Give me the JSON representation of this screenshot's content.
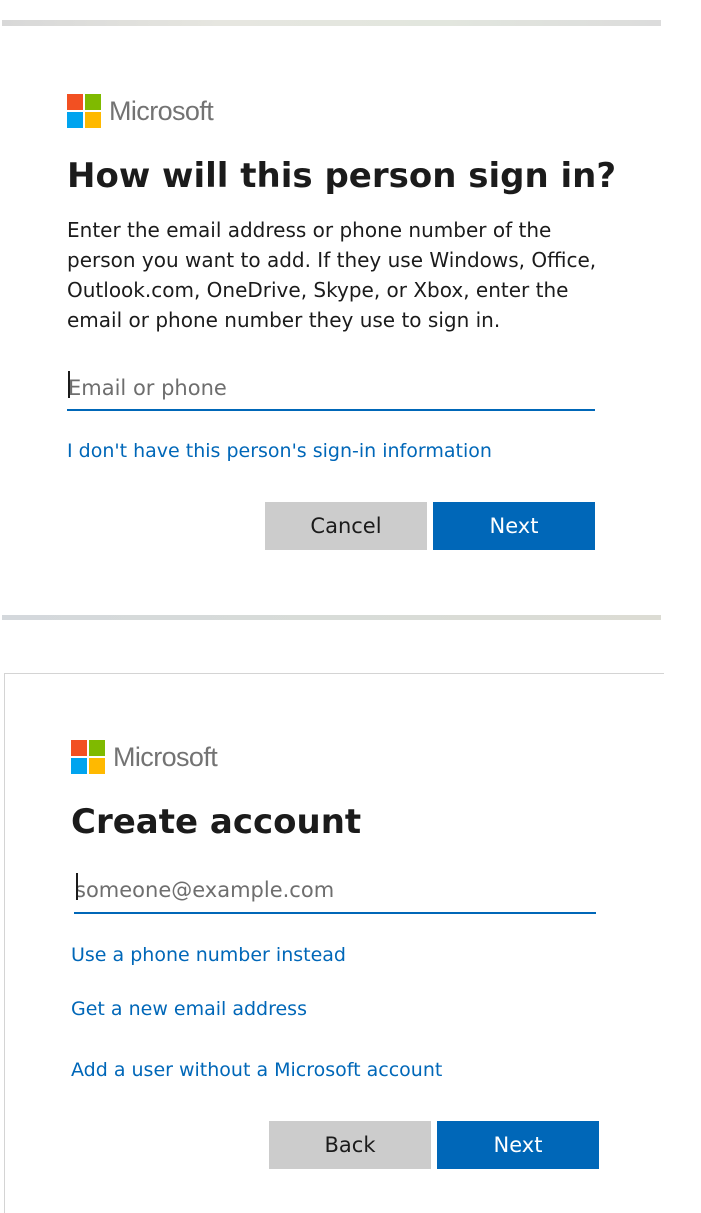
{
  "sign_in_panel": {
    "brand": "Microsoft",
    "title": "How will this person sign in?",
    "description": "Enter the email address or phone number of the person you want to add. If they use Windows, Office, Outlook.com, OneDrive, Skype, or Xbox, enter the email or phone number they use to sign in.",
    "email_input": {
      "placeholder": "Email or phone",
      "value": ""
    },
    "no_signin_info_link": "I don't have this person's sign-in information",
    "cancel_button": "Cancel",
    "next_button": "Next"
  },
  "create_account_panel": {
    "brand": "Microsoft",
    "title": "Create account",
    "email_input": {
      "placeholder": "someone@example.com",
      "value": ""
    },
    "use_phone_link": "Use a phone number instead",
    "new_email_link": "Get a new email address",
    "no_ms_account_link": "Add a user without a Microsoft account",
    "back_button": "Back",
    "next_button": "Next"
  },
  "colors": {
    "accent": "#0067b8",
    "secondary_button": "#cccccc",
    "text": "#1b1b1b",
    "logo": [
      "#f25022",
      "#7fba00",
      "#00a4ef",
      "#ffb900"
    ]
  }
}
